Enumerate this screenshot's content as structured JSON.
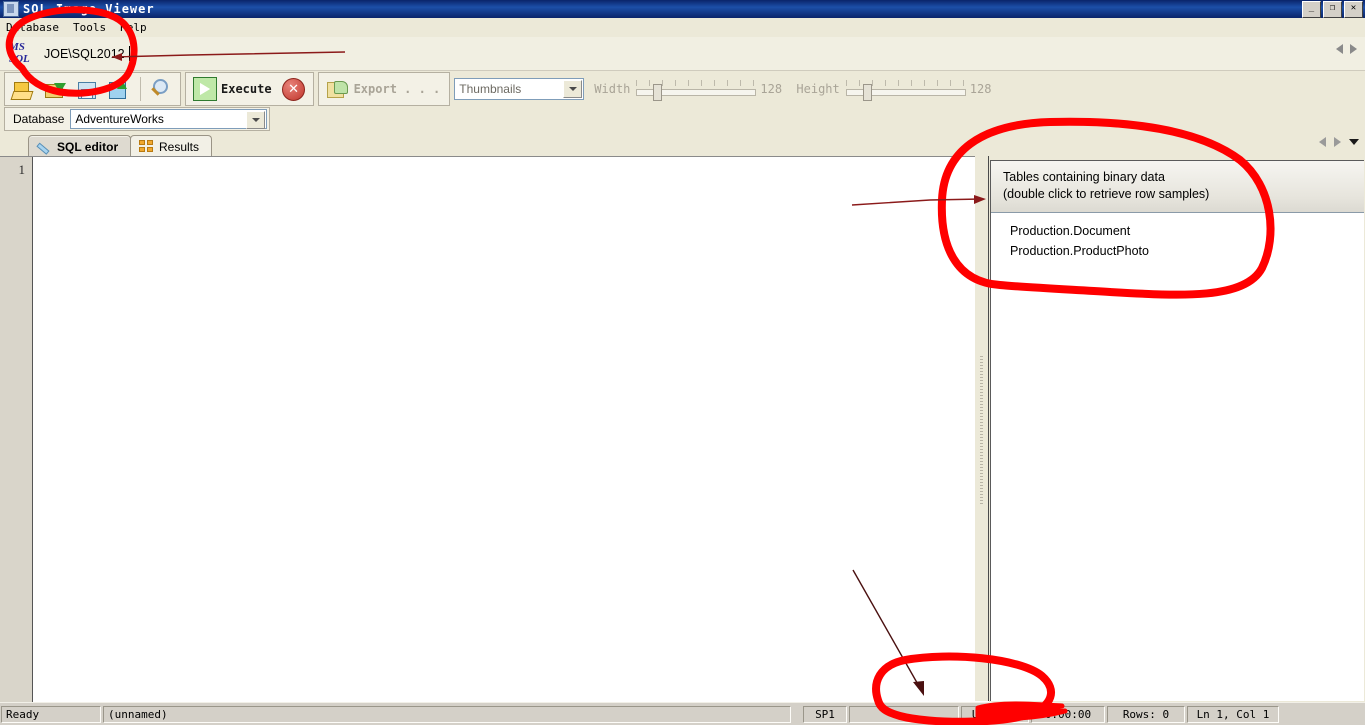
{
  "window": {
    "title": "SQL Image Viewer",
    "icon": "app-icon",
    "buttons": {
      "minimize": "_",
      "restore": "❐",
      "close": "✕"
    }
  },
  "menu": {
    "items": [
      {
        "label": "Database"
      },
      {
        "label": "Tools"
      },
      {
        "label": "Help"
      }
    ]
  },
  "server_bar": {
    "logo_line1": "MS",
    "logo_line2": "SQL",
    "server_name": "JOE\\SQL2012"
  },
  "toolbar": {
    "buttons": [
      {
        "name": "open-database-icon",
        "tooltip": "Open database"
      },
      {
        "name": "open-file-icon",
        "tooltip": "Open"
      },
      {
        "name": "save-icon",
        "tooltip": "Save"
      },
      {
        "name": "save-as-icon",
        "tooltip": "Save as"
      },
      {
        "name": "search-icon",
        "tooltip": "Search"
      }
    ],
    "execute_label": "Execute",
    "stop_label": "✕",
    "export_label": "Export . . .",
    "view_mode": "Thumbnails",
    "width_label": "Width",
    "width_value": "128",
    "height_label": "Height",
    "height_value": "128"
  },
  "database_bar": {
    "label": "Database",
    "value": "AdventureWorks"
  },
  "tabs": {
    "items": [
      {
        "label": "SQL editor",
        "icon": "pencil-icon",
        "active": true
      },
      {
        "label": "Results",
        "icon": "grid-icon",
        "active": false
      }
    ]
  },
  "editor": {
    "line_number": "1",
    "content": ""
  },
  "right_panel": {
    "header_line1": "Tables containing binary data",
    "header_line2": "(double click to retrieve row samples)",
    "tables": [
      {
        "label": "Production.Document"
      },
      {
        "label": "Production.ProductPhoto"
      }
    ]
  },
  "status_bar": {
    "ready": "Ready",
    "document": "(unnamed)",
    "sp": "SP1",
    "obscured": "",
    "encoding": "Unicode",
    "elapsed": "0:00:00",
    "rows": "Rows: 0",
    "caret": "Ln 1, Col 1"
  },
  "colors": {
    "annotation": "#ff0000",
    "arrow": "#8b1a1a",
    "titlebar": "#0a246a",
    "face": "#ece9d8"
  }
}
